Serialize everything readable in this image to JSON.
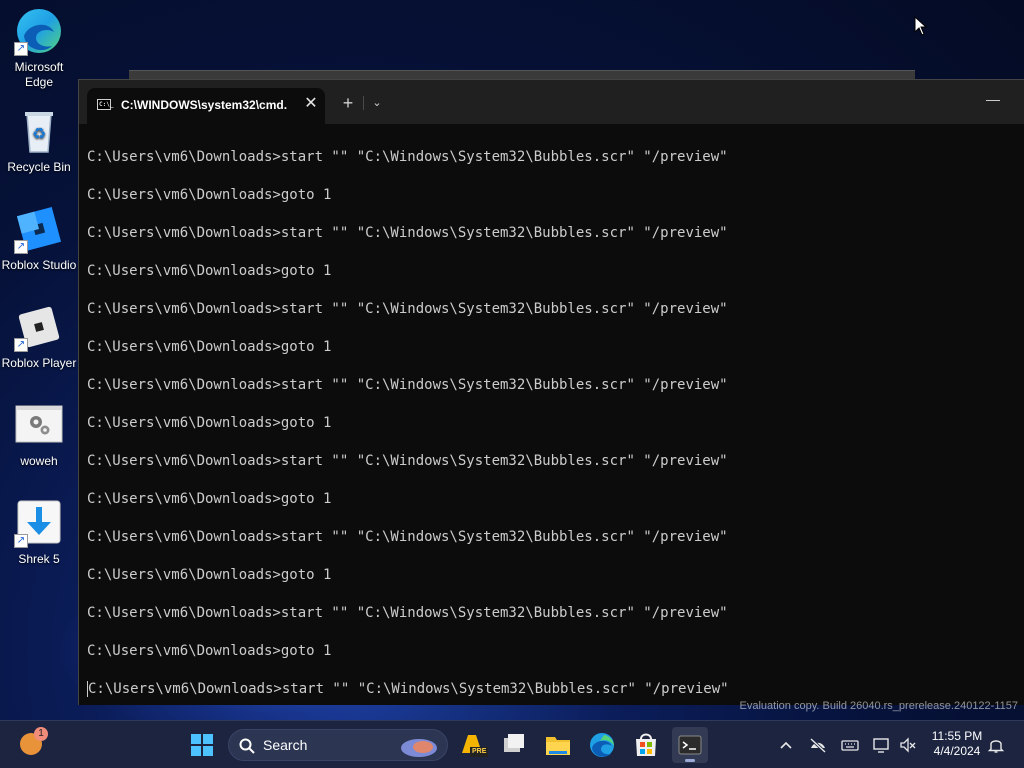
{
  "desktop": {
    "icons": [
      {
        "label": "Microsoft Edge",
        "icon": "edge-icon"
      },
      {
        "label": "Recycle Bin",
        "icon": "recycle-bin-icon"
      },
      {
        "label": "Roblox Studio",
        "icon": "roblox-studio-icon"
      },
      {
        "label": "Roblox Player",
        "icon": "roblox-player-icon"
      },
      {
        "label": "woweh",
        "icon": "settings-file-icon"
      },
      {
        "label": "Shrek 5",
        "icon": "download-arrow-icon"
      }
    ]
  },
  "terminal": {
    "tab_title": "C:\\WINDOWS\\system32\\cmd.",
    "tab_icon_text": "C:\\_",
    "close_label": "✕",
    "new_tab_label": "+",
    "dropdown_label": "⌄",
    "minimize_label": "—",
    "lines": [
      "C:\\Users\\vm6\\Downloads>start \"\" \"C:\\Windows\\System32\\Bubbles.scr\" \"/preview\"",
      "C:\\Users\\vm6\\Downloads>goto 1",
      "C:\\Users\\vm6\\Downloads>start \"\" \"C:\\Windows\\System32\\Bubbles.scr\" \"/preview\"",
      "C:\\Users\\vm6\\Downloads>goto 1",
      "C:\\Users\\vm6\\Downloads>start \"\" \"C:\\Windows\\System32\\Bubbles.scr\" \"/preview\"",
      "C:\\Users\\vm6\\Downloads>goto 1",
      "C:\\Users\\vm6\\Downloads>start \"\" \"C:\\Windows\\System32\\Bubbles.scr\" \"/preview\"",
      "C:\\Users\\vm6\\Downloads>goto 1",
      "C:\\Users\\vm6\\Downloads>start \"\" \"C:\\Windows\\System32\\Bubbles.scr\" \"/preview\"",
      "C:\\Users\\vm6\\Downloads>goto 1",
      "C:\\Users\\vm6\\Downloads>start \"\" \"C:\\Windows\\System32\\Bubbles.scr\" \"/preview\"",
      "C:\\Users\\vm6\\Downloads>goto 1",
      "C:\\Users\\vm6\\Downloads>start \"\" \"C:\\Windows\\System32\\Bubbles.scr\" \"/preview\"",
      "C:\\Users\\vm6\\Downloads>goto 1",
      "C:\\Users\\vm6\\Downloads>start \"\" \"C:\\Windows\\System32\\Bubbles.scr\" \"/preview\""
    ]
  },
  "watermark": "Evaluation copy. Build 26040.rs_prerelease.240122-1157",
  "taskbar": {
    "weather_badge": "1",
    "search_placeholder": "Search",
    "pre_badge": "PRE",
    "clock_time": "11:55 PM",
    "clock_date": "4/4/2024",
    "pinned": [
      "windows-start-icon",
      "task-view-icon",
      "file-explorer-icon",
      "edge-icon",
      "microsoft-store-icon",
      "terminal-icon"
    ],
    "tray": [
      "chevron-up-icon",
      "network-off-icon",
      "keyboard-icon",
      "display-icon",
      "volume-mute-icon",
      "notification-bell-icon"
    ]
  },
  "colors": {
    "console_text": "#cccccc",
    "console_bg": "#0c0c0c",
    "titlebar_bg": "#202020",
    "taskbar_bg": "#1c2440",
    "accent": "#0078d4"
  }
}
